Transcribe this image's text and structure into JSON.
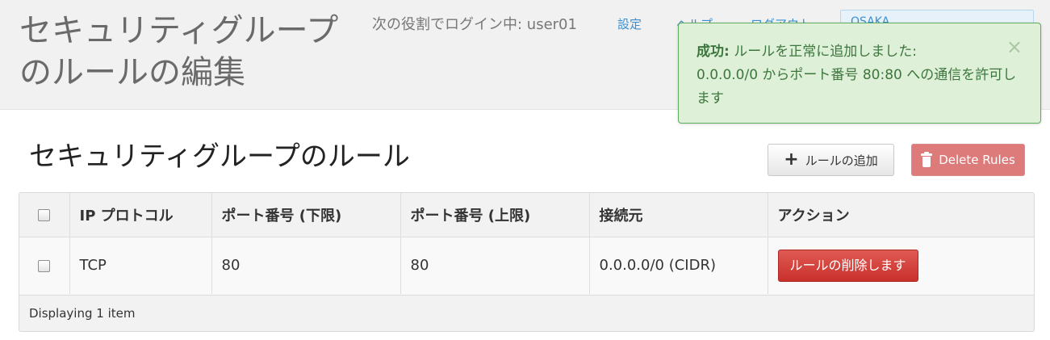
{
  "header": {
    "title": "セキュリティグループのルールの編集",
    "user_info": "次の役割でログイン中: user01",
    "nav": {
      "settings": "設定",
      "help": "ヘルプ",
      "logout": "ログアウト"
    },
    "region": "OSAKA"
  },
  "alert": {
    "label": "成功:",
    "message_1": " ルールを正常に追加しました:",
    "cidr": "0.0.0.0/0",
    "message_2": " からポート番号 ",
    "port_range": "80:80",
    "message_3": " への通信を許可します",
    "close": "×"
  },
  "section": {
    "title": "セキュリティグループのルール",
    "add_label": "ルールの追加",
    "delete_rules_label": "Delete Rules"
  },
  "table": {
    "headers": {
      "protocol": "IP プロトコル",
      "port_min": "ポート番号 (下限)",
      "port_max": "ポート番号 (上限)",
      "source": "接続元",
      "actions": "アクション"
    },
    "rows": [
      {
        "protocol": "TCP",
        "port_min": "80",
        "port_max": "80",
        "source": "0.0.0.0/0 (CIDR)",
        "action": "ルールの削除します"
      }
    ],
    "footer": "Displaying 1 item"
  },
  "colors": {
    "success_bg": "#dff0d8",
    "success_text": "#3c763d",
    "danger": "#c9302c",
    "link": "#3b8ecf"
  }
}
